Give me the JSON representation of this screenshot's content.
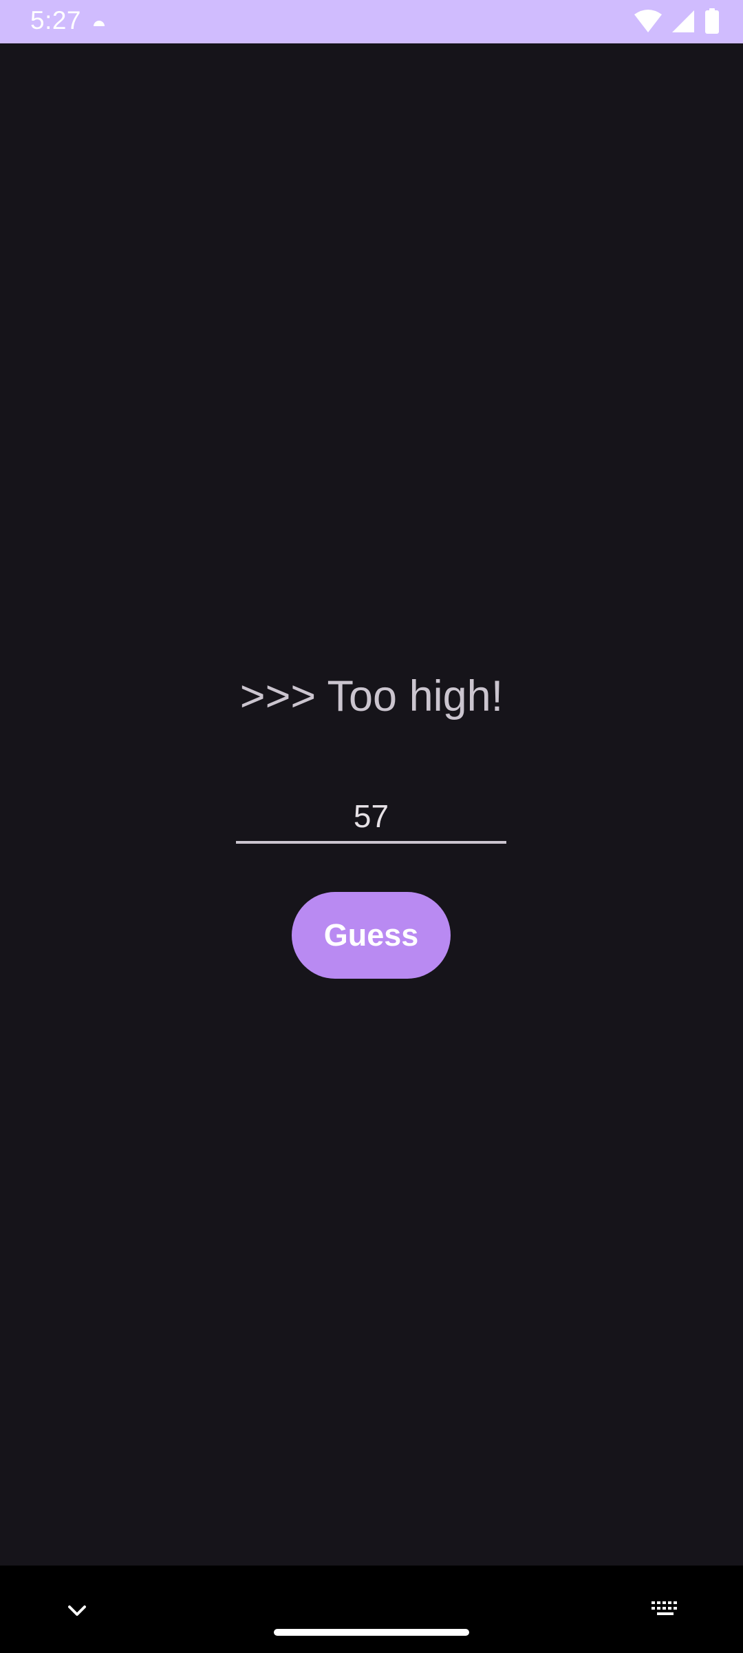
{
  "status_bar": {
    "time": "5:27",
    "icons": [
      "notification-icon",
      "wifi-icon",
      "cell-signal-icon",
      "battery-icon"
    ]
  },
  "game": {
    "message": ">>> Too high!",
    "guess_value": "57",
    "guess_button_label": "Guess"
  },
  "nav_bar": {
    "icons": [
      "chevron-down-icon",
      "keyboard-icon",
      "home-handle"
    ]
  },
  "colors": {
    "status_bar_bg": "#d0bcfe",
    "background": "#16141a",
    "accent": "#b98af2",
    "text": "#cbc5cf"
  }
}
